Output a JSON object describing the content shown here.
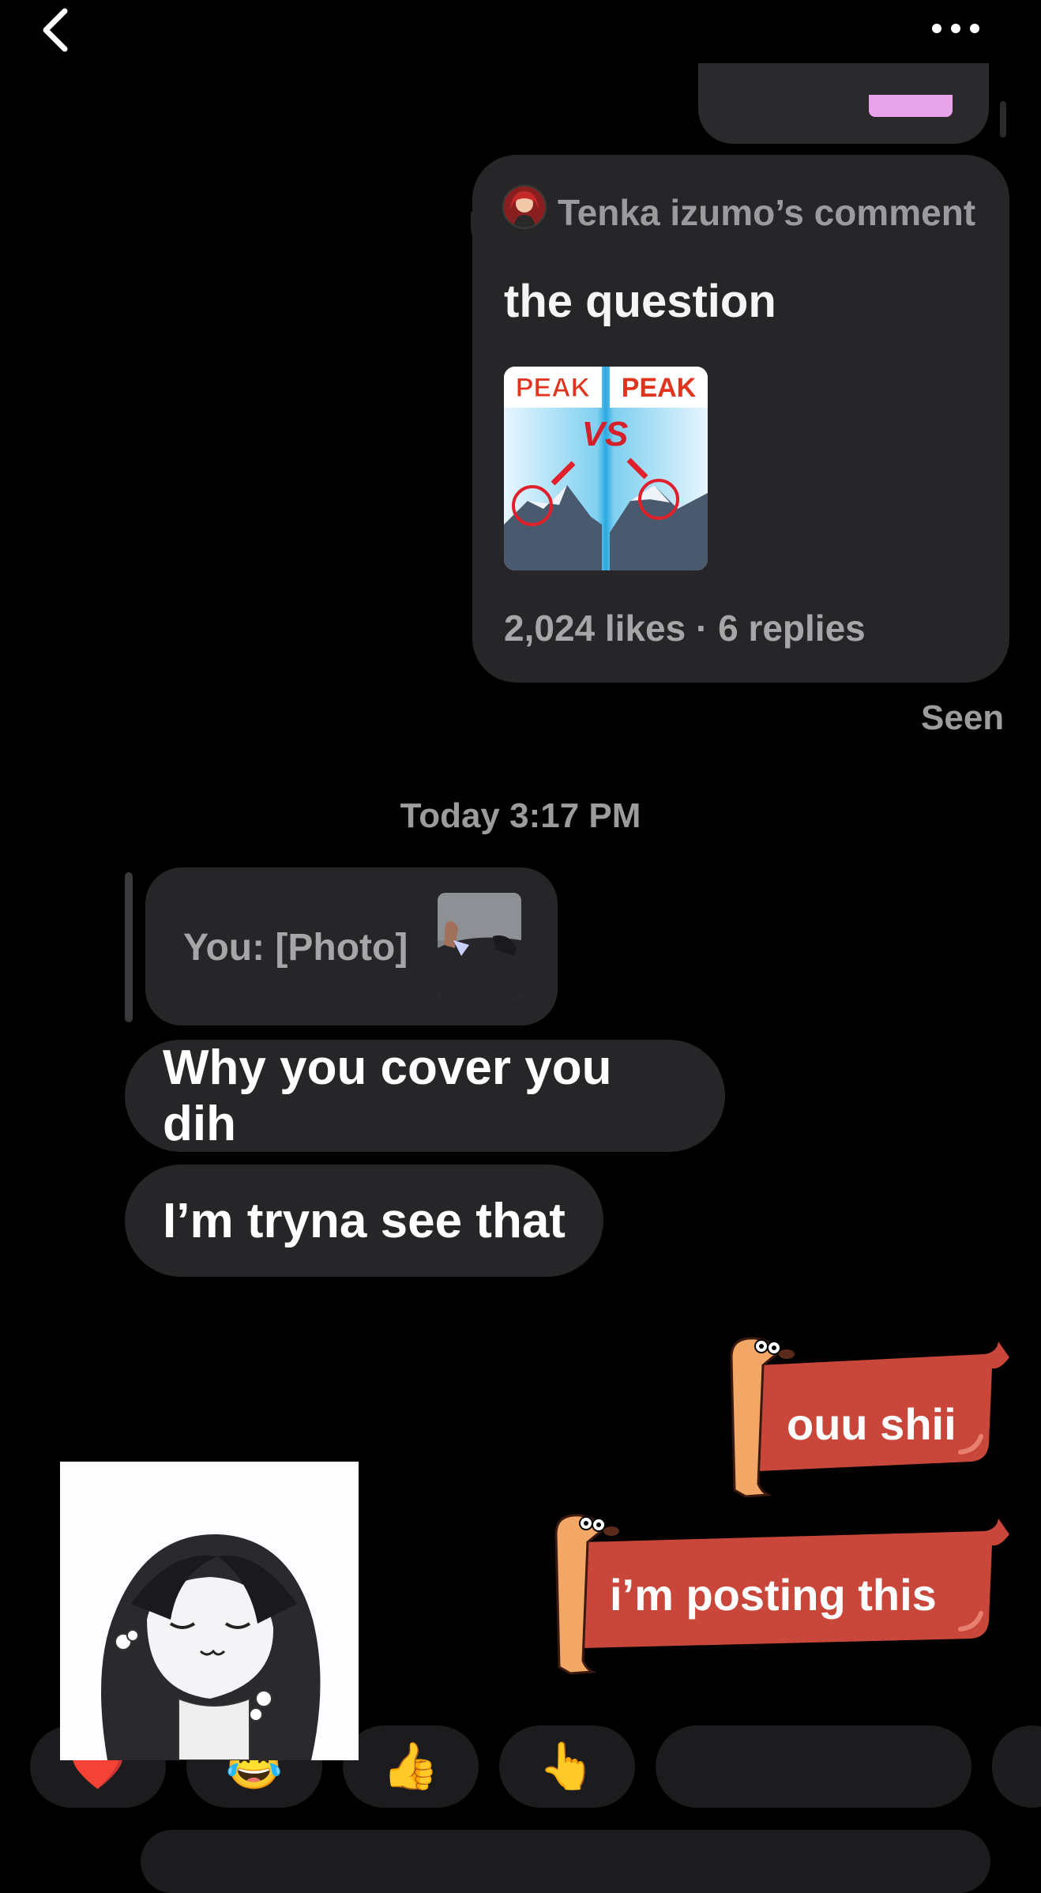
{
  "header": {
    "back_icon": "chevron-left-icon",
    "more_icon": "more-horizontal-icon"
  },
  "comment_share": {
    "author_label": "Tenka izumo’s comment",
    "comment_text": "the question",
    "thumbnail_left_label": "PEAK",
    "thumbnail_right_label": "PEAK",
    "thumbnail_vs": "VS",
    "stats": "2,024 likes · 6 replies"
  },
  "seen_label": "Seen",
  "timestamp": "Today 3:17 PM",
  "reply_preview": {
    "text": "You: [Photo]"
  },
  "messages": [
    {
      "sender": "them",
      "text": "Why you cover you dih"
    },
    {
      "sender": "them",
      "text": "I’m tryna see that"
    },
    {
      "sender": "me",
      "type": "sticker",
      "text": "ouu shii"
    },
    {
      "sender": "me",
      "type": "sticker",
      "text": "i’m posting this"
    }
  ],
  "quick_reactions": [
    "❤️",
    "😂",
    "👍",
    "👆"
  ],
  "colors": {
    "background": "#000000",
    "bubble": "#262628",
    "sticker_red": "#c9473a",
    "muted_text": "#9c9c9e"
  }
}
